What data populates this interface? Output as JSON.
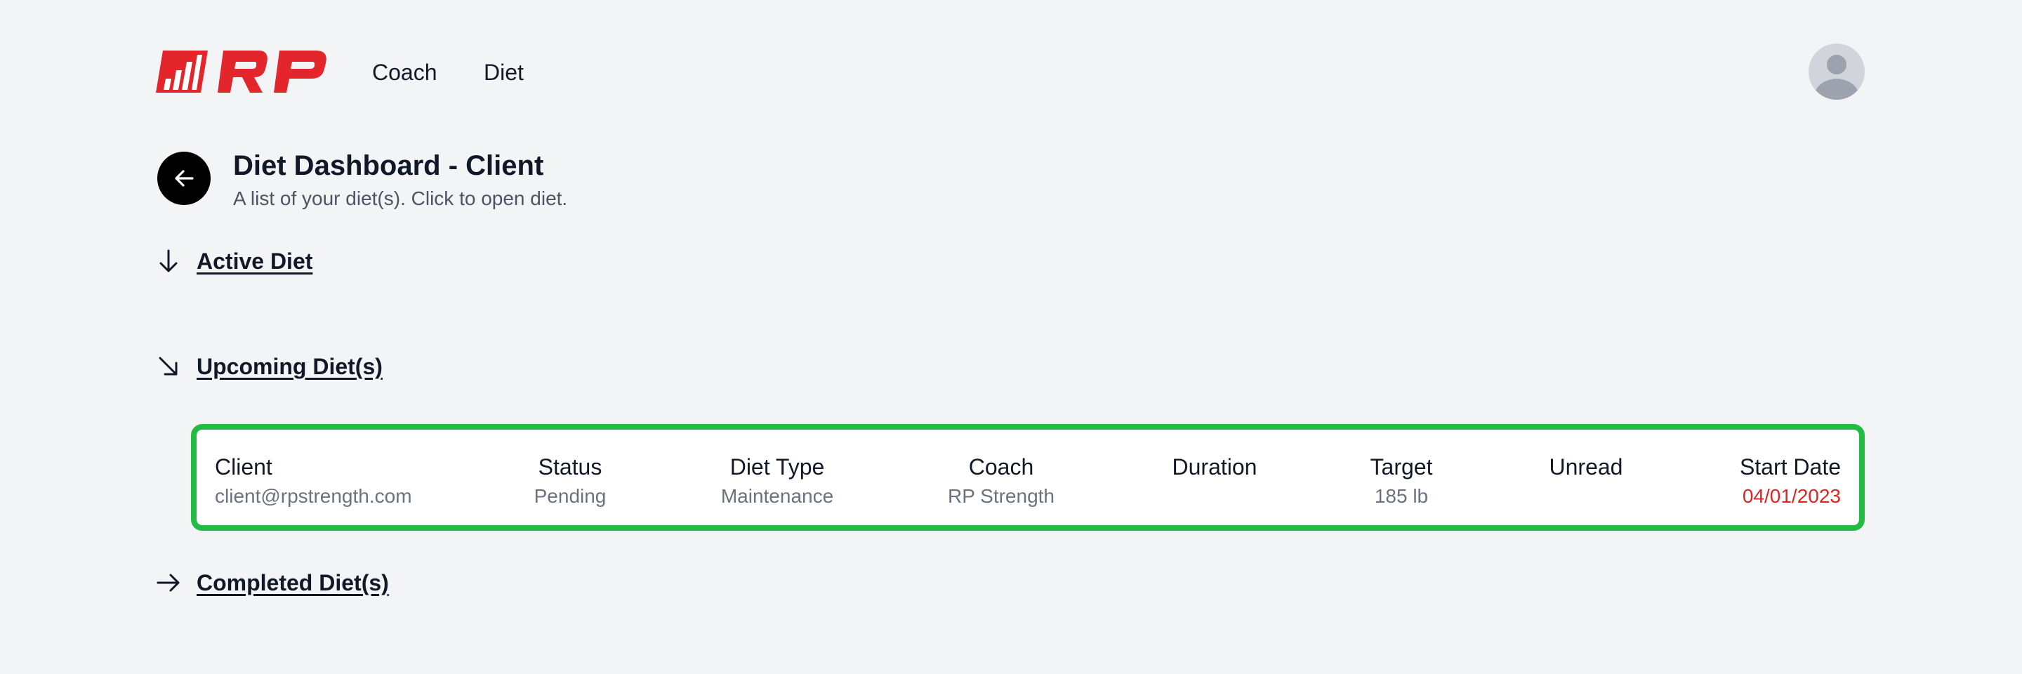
{
  "header": {
    "brand": "RP",
    "nav": [
      {
        "label": "Coach"
      },
      {
        "label": "Diet"
      }
    ],
    "colors": {
      "brand": "#e3262c"
    }
  },
  "title_block": {
    "title": "Diet Dashboard - Client",
    "subtitle": "A list of your diet(s). Click to open diet."
  },
  "sections": {
    "active": {
      "label": "Active Diet",
      "icon": "arrow-down-icon"
    },
    "upcoming": {
      "label": "Upcoming Diet(s)",
      "icon": "arrow-down-right-icon"
    },
    "completed": {
      "label": "Completed Diet(s)",
      "icon": "arrow-right-icon"
    }
  },
  "upcoming_diet": {
    "columns": [
      {
        "key": "client",
        "header": "Client",
        "value": "client@rpstrength.com"
      },
      {
        "key": "status",
        "header": "Status",
        "value": "Pending"
      },
      {
        "key": "diet_type",
        "header": "Diet Type",
        "value": "Maintenance"
      },
      {
        "key": "coach",
        "header": "Coach",
        "value": "RP Strength"
      },
      {
        "key": "duration",
        "header": "Duration",
        "value": ""
      },
      {
        "key": "target",
        "header": "Target",
        "value": "185 lb"
      },
      {
        "key": "unread",
        "header": "Unread",
        "value": ""
      },
      {
        "key": "start_date",
        "header": "Start Date",
        "value": "04/01/2023"
      }
    ],
    "highlight_color": "#22bb44",
    "start_date_color": "#dc2626"
  }
}
